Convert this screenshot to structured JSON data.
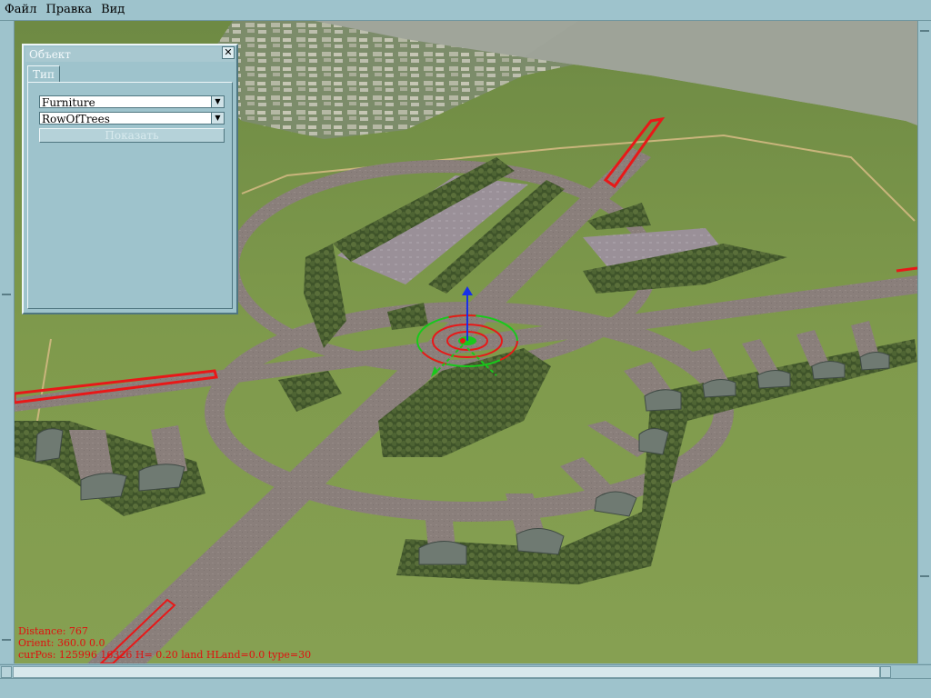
{
  "menu": {
    "items": [
      "Файл",
      "Правка",
      "Вид"
    ]
  },
  "dialog": {
    "title": "Объект",
    "close_glyph": "✕",
    "tab_label": "Тип",
    "type_select": {
      "value": "Furniture"
    },
    "object_select": {
      "value": "RowOfTrees"
    },
    "show_button_label": "Показать"
  },
  "hud": {
    "distance": "Distance: 767",
    "orient": "Orient: 360.0 0.0",
    "curpos": "curPos: 125996 16326 H= 0.20 land HLand=0.0 type=30"
  },
  "icons": {
    "close": "close-icon",
    "dropdown": "chevron-down-icon",
    "gizmo": "move-gizmo-icon"
  },
  "colors": {
    "ui_bg": "#9ec3cc",
    "hud_text": "#e01010",
    "terrain": "#7c9448",
    "road": "#8a7d78",
    "trees": "#4a5e30"
  }
}
